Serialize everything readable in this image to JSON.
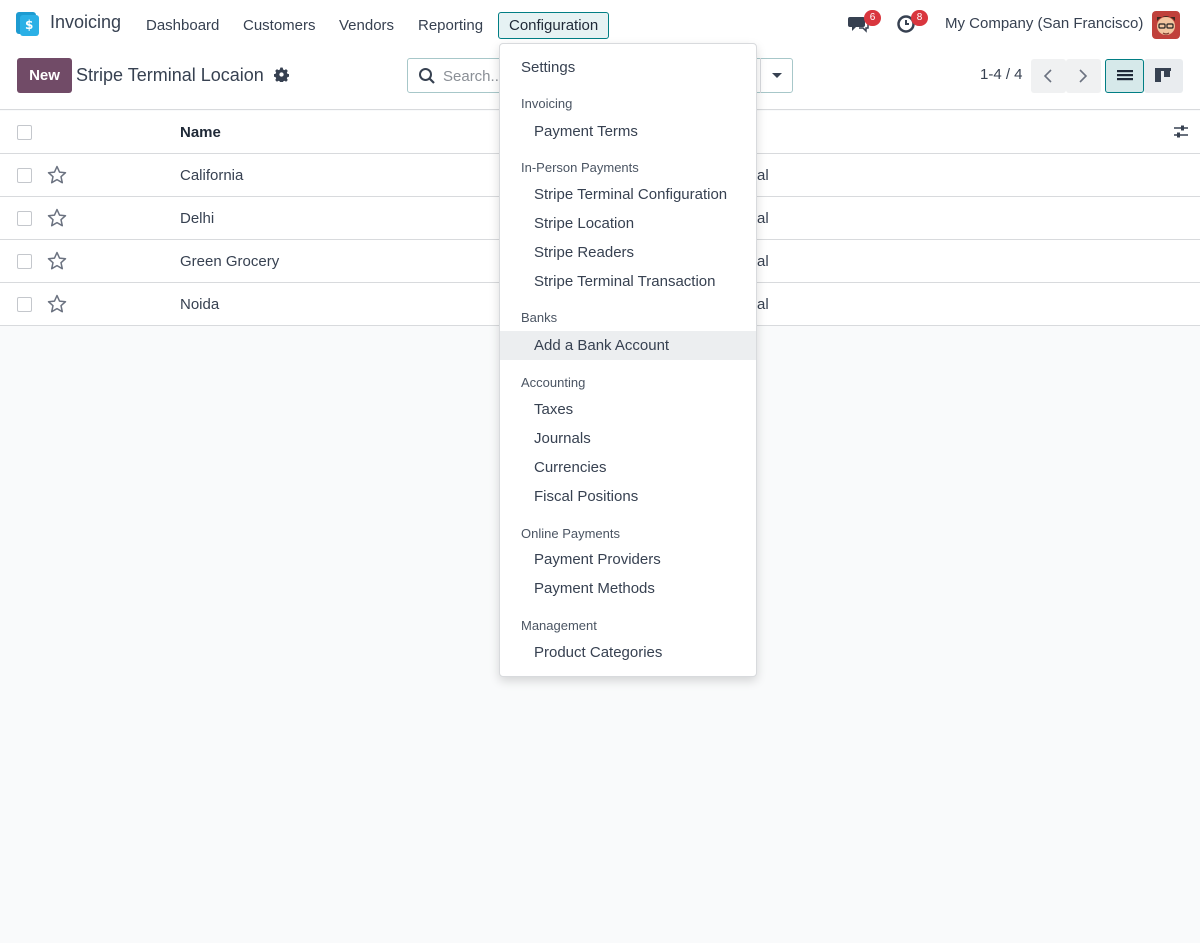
{
  "navbar": {
    "app_name": "Invoicing",
    "menu": [
      "Dashboard",
      "Customers",
      "Vendors",
      "Reporting",
      "Configuration"
    ],
    "active_menu": "Configuration",
    "messages_badge": "6",
    "activities_badge": "8",
    "company": "My Company (San Francisco)"
  },
  "control_panel": {
    "new_label": "New",
    "title": "Stripe Terminal Locaion",
    "search_placeholder": "Search...",
    "pager": "1-4 / 4"
  },
  "list": {
    "header_name": "Name",
    "rows": [
      {
        "name": "California",
        "truncated": "al"
      },
      {
        "name": "Delhi",
        "truncated": "al"
      },
      {
        "name": "Green Grocery",
        "truncated": "al"
      },
      {
        "name": "Noida",
        "truncated": "al"
      }
    ]
  },
  "dropdown": {
    "settings": "Settings",
    "invoicing_header": "Invoicing",
    "payment_terms": "Payment Terms",
    "in_person_header": "In-Person Payments",
    "stripe_terminal_configuration": "Stripe Terminal Configuration",
    "stripe_location": "Stripe Location",
    "stripe_readers": "Stripe Readers",
    "stripe_terminal_transaction": "Stripe Terminal Transaction",
    "banks_header": "Banks",
    "add_bank_account": "Add a Bank Account",
    "accounting_header": "Accounting",
    "taxes": "Taxes",
    "journals": "Journals",
    "currencies": "Currencies",
    "fiscal_positions": "Fiscal Positions",
    "online_payments_header": "Online Payments",
    "payment_providers": "Payment Providers",
    "payment_methods": "Payment Methods",
    "management_header": "Management",
    "product_categories": "Product Categories"
  },
  "colors": {
    "brand": "#714b67",
    "accent": "#017e84",
    "badge": "#d9363e"
  }
}
